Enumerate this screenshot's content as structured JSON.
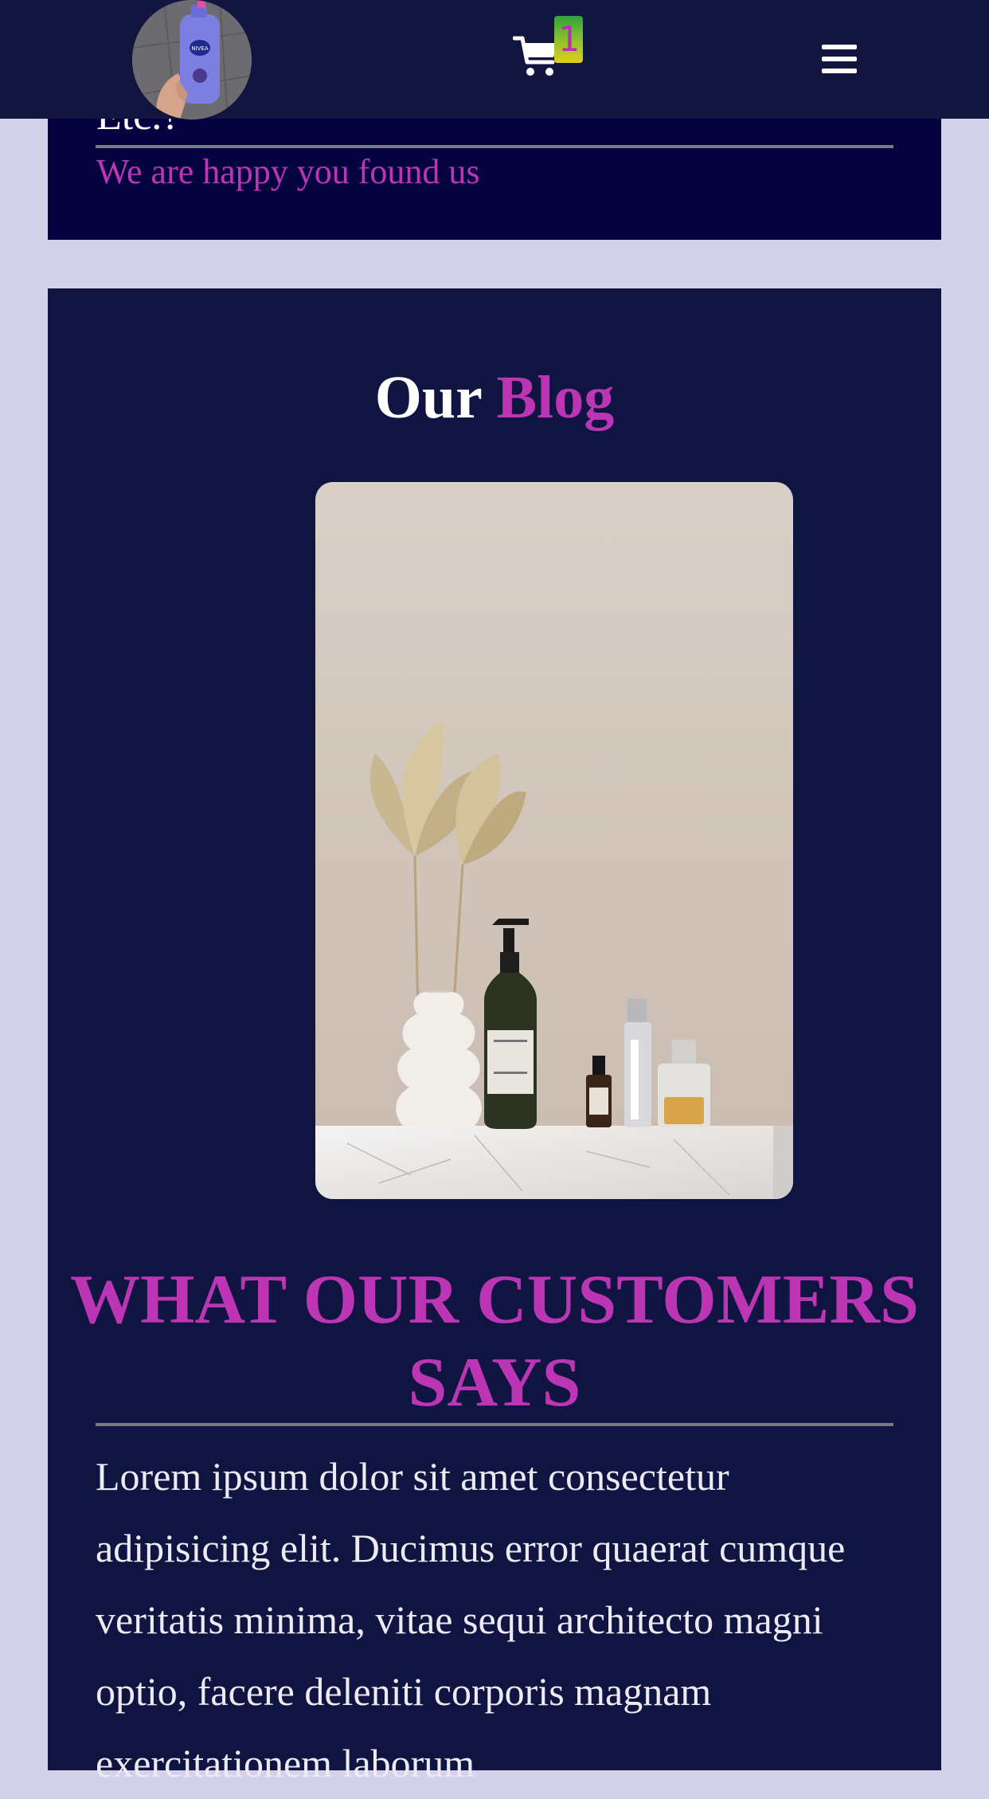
{
  "colors": {
    "page_background": "#d4d1ea",
    "navbar": "#11153f",
    "card": "#0f1440",
    "accent": "#bc35b5",
    "text_light": "#ffffff"
  },
  "navbar": {
    "logo_icon": "product-bottle-avatar-icon",
    "cart_icon": "shopping-cart-icon",
    "cart_count": "1",
    "menu_icon": "hamburger-menu-icon"
  },
  "hero": {
    "title_fragment": "Etc.?",
    "subtitle": "We are happy you found us"
  },
  "blog": {
    "heading_white": "Our",
    "heading_accent": "Blog",
    "image_icon": "cosmetics-bottles-vase-photo"
  },
  "testimonials": {
    "heading": "WHAT OUR CUSTOMERS SAYS",
    "body": "Lorem ipsum dolor sit amet consectetur adipisicing elit. Ducimus error quaerat cumque veritatis minima, vitae sequi architecto magni optio, facere deleniti corporis magnam exercitationem laborum"
  }
}
